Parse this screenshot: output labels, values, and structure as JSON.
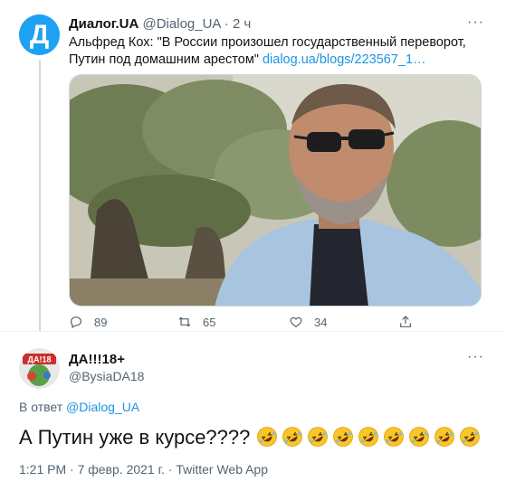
{
  "tweet1": {
    "author_name": "Диалог.UA",
    "author_handle": "@Dialog_UA",
    "separator": "·",
    "time": "2 ч",
    "text_before_link": "Альфред Кох: \"В России произошел государственный переворот, Путин под домашним арестом\"",
    "link_text": "dialog.ua/blogs/223567_1…",
    "avatar_letter": "Д",
    "actions": {
      "replies": "89",
      "retweets": "65",
      "likes": "34"
    }
  },
  "tweet2": {
    "author_name": "ДА!!!18+",
    "author_handle": "@BysiaDA18",
    "avatar_text": "ДА!18",
    "reply_prefix": "В ответ",
    "reply_to": "@Dialog_UA",
    "text": "А Путин уже в курсе????",
    "emoji_count": 9,
    "emoji_name": "rolling-on-floor-laughing",
    "meta": "1:21 PM · 7 февр. 2021 г. · Twitter Web App"
  },
  "more_glyph": "···",
  "colors": {
    "accent": "#1da1f2",
    "link": "#1b95e0",
    "muted": "#536471"
  }
}
